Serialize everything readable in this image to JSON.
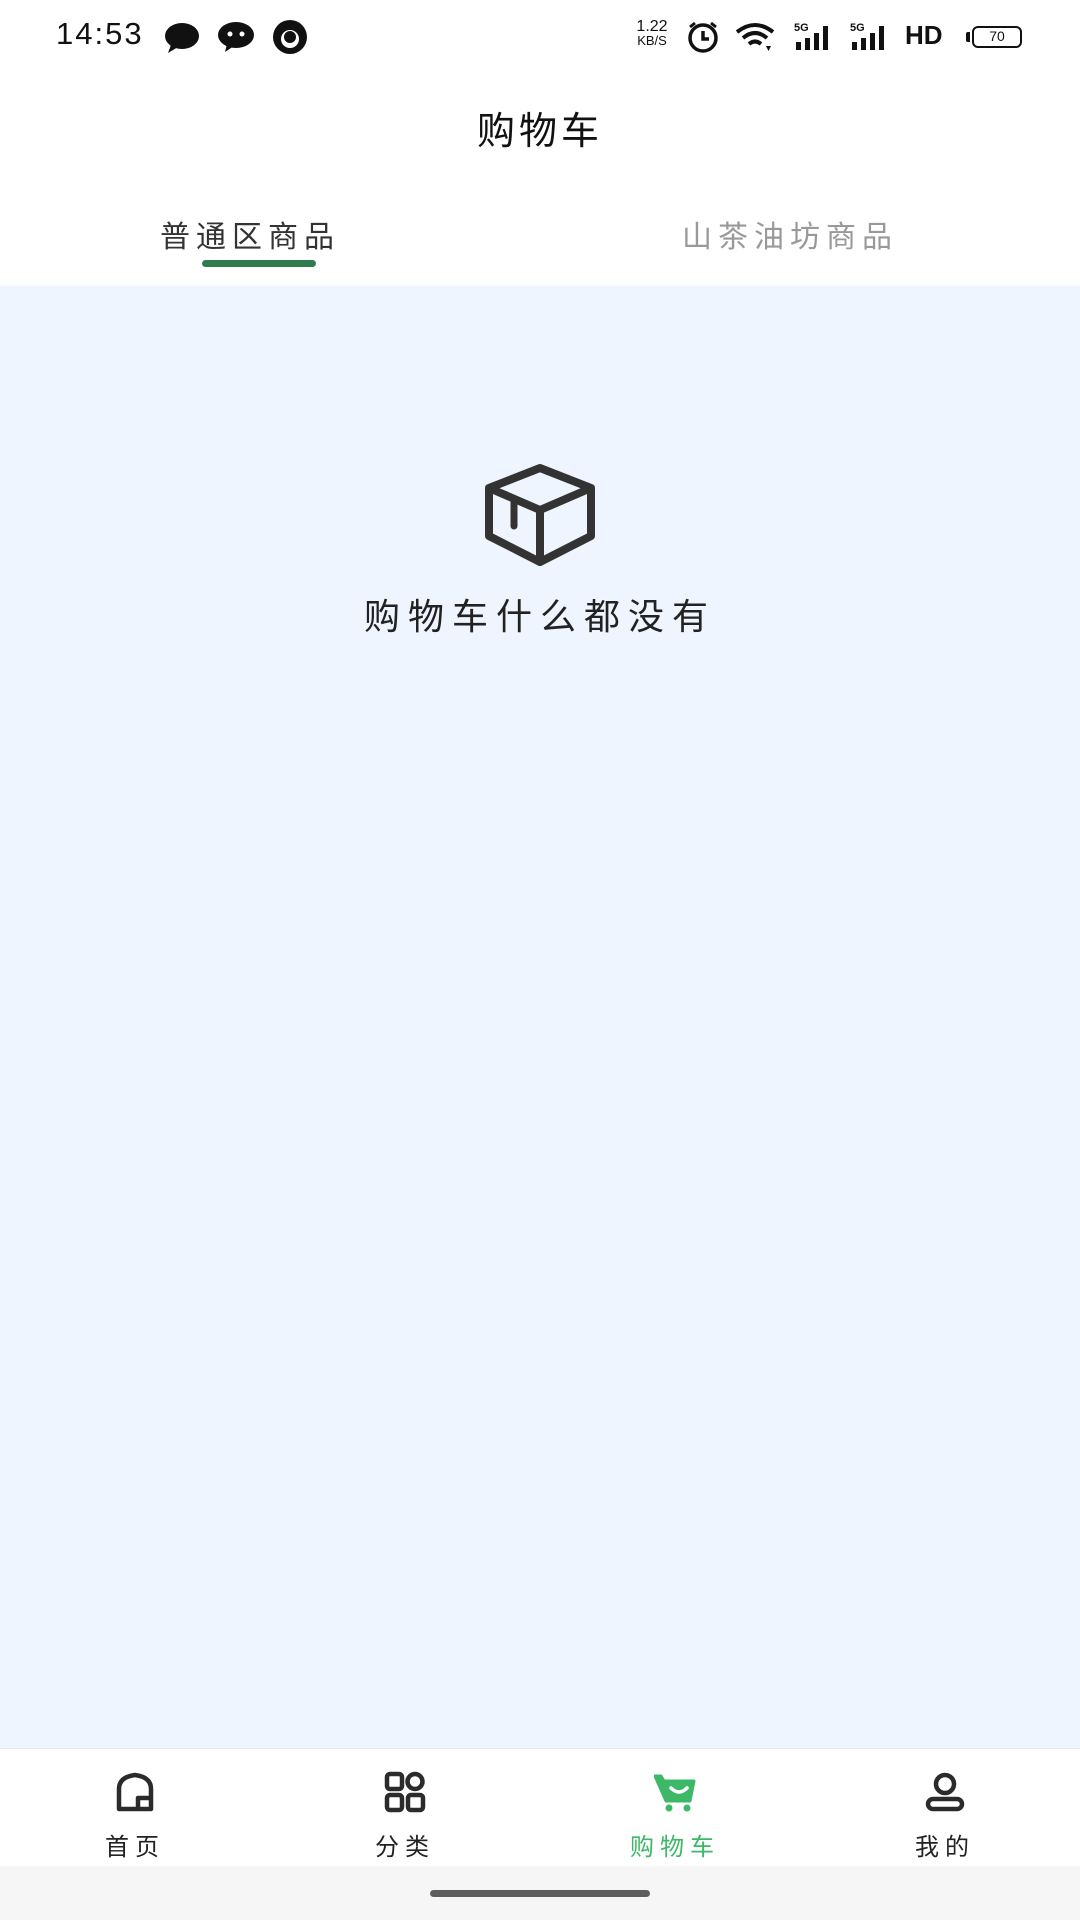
{
  "status_bar": {
    "time": "14:53",
    "net_speed_value": "1.22",
    "net_speed_unit": "KB/S",
    "hd_label": "HD",
    "battery": "70",
    "icons": [
      "chat-bubble-icon",
      "wechat-icon",
      "browser-icon",
      "alarm-icon",
      "wifi-icon",
      "signal-5g-icon",
      "signal-5g-icon"
    ]
  },
  "header": {
    "title": "购物车",
    "tabs": [
      {
        "label": "普通区商品",
        "active": true
      },
      {
        "label": "山茶油坊商品",
        "active": false
      }
    ]
  },
  "empty_state": {
    "icon": "box-icon",
    "message": "购物车什么都没有"
  },
  "bottom_nav": {
    "items": [
      {
        "label": "首页",
        "icon": "home-icon",
        "active": false
      },
      {
        "label": "分类",
        "icon": "category-icon",
        "active": false
      },
      {
        "label": "购物车",
        "icon": "cart-icon",
        "active": true
      },
      {
        "label": "我的",
        "icon": "user-icon",
        "active": false
      }
    ]
  },
  "colors": {
    "accent_green": "#3cb867",
    "tab_indicator": "#2f7a4e",
    "content_background": "#eff5fe",
    "inactive_tab": "#999999"
  }
}
